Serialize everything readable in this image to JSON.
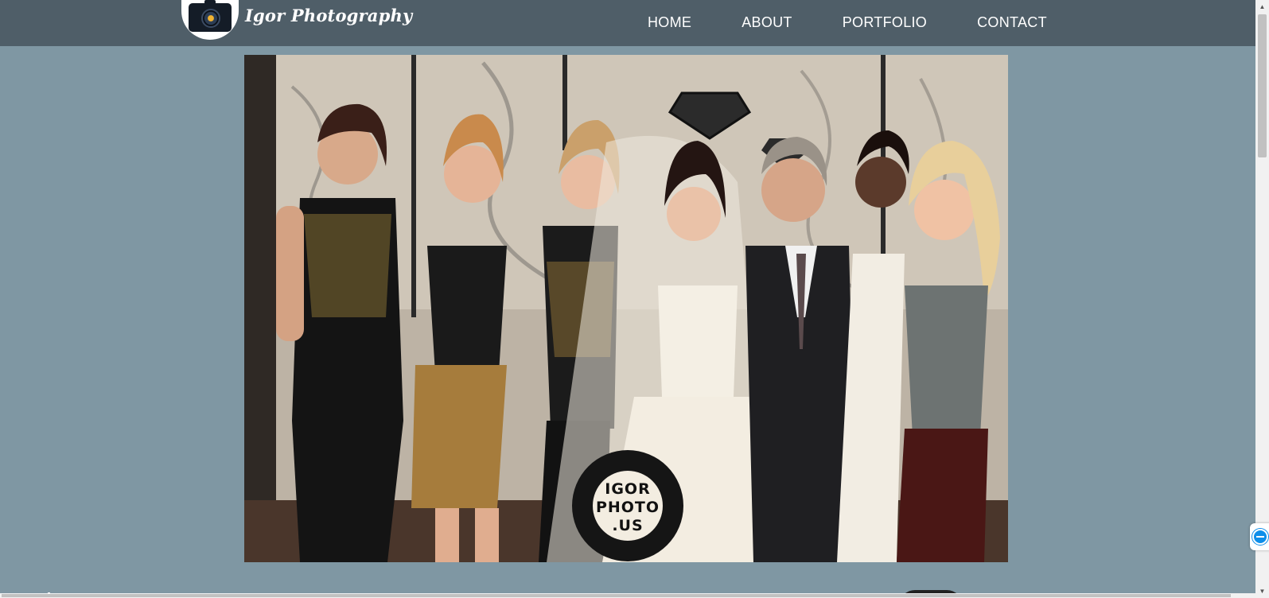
{
  "site": {
    "logo_text": "Igor Photography"
  },
  "nav": {
    "items": [
      {
        "label": "HOME"
      },
      {
        "label": "ABOUT"
      },
      {
        "label": "PORTFOLIO"
      },
      {
        "label": "CONTACT"
      }
    ]
  },
  "hero": {
    "watermark_lines": [
      "IGOR",
      "PHOTO",
      ".US"
    ]
  },
  "colors": {
    "header_bg": "#4f5e68",
    "page_bg": "#7f97a3",
    "nav_text": "#ffffff"
  },
  "icons": {
    "logo": "camera-icon",
    "widget": "teamviewer-icon"
  }
}
